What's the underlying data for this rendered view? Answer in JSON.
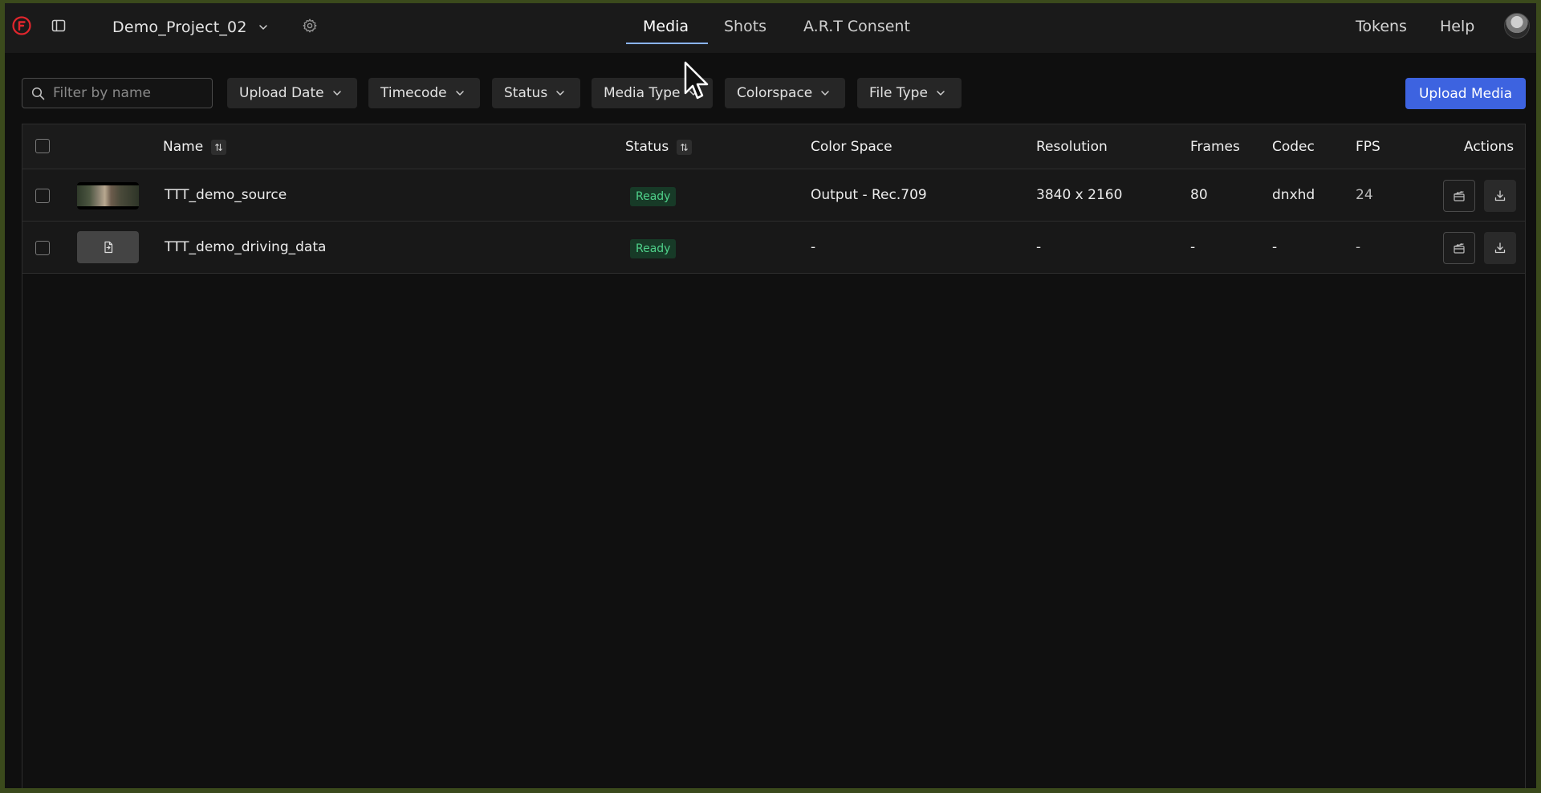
{
  "header": {
    "project_name": "Demo_Project_02",
    "tabs": [
      {
        "label": "Media",
        "active": true
      },
      {
        "label": "Shots",
        "active": false
      },
      {
        "label": "A.R.T Consent",
        "active": false
      }
    ],
    "links": {
      "tokens": "Tokens",
      "help": "Help"
    }
  },
  "filters": {
    "search_placeholder": "Filter by name",
    "search_value": "",
    "buttons": [
      {
        "label": "Upload Date"
      },
      {
        "label": "Timecode"
      },
      {
        "label": "Status"
      },
      {
        "label": "Media Type"
      },
      {
        "label": "Colorspace"
      },
      {
        "label": "File Type"
      }
    ],
    "upload_label": "Upload Media"
  },
  "table": {
    "columns": {
      "name": "Name",
      "status": "Status",
      "color_space": "Color Space",
      "resolution": "Resolution",
      "frames": "Frames",
      "codec": "Codec",
      "fps": "FPS",
      "actions": "Actions"
    },
    "rows": [
      {
        "thumbnail": "video-frame",
        "name": "TTT_demo_source",
        "status": "Ready",
        "color_space": "Output - Rec.709",
        "resolution": "3840 x 2160",
        "frames": "80",
        "codec": "dnxhd",
        "fps": "24"
      },
      {
        "thumbnail": "file-icon",
        "name": "TTT_demo_driving_data",
        "status": "Ready",
        "color_space": "-",
        "resolution": "-",
        "frames": "-",
        "codec": "-",
        "fps": "-"
      }
    ]
  },
  "colors": {
    "accent": "#3d63e0",
    "tab_underline": "#8ab4ff",
    "ready_text": "#4fd18a",
    "ready_bg": "#173a27",
    "logo": "#e0262d"
  }
}
